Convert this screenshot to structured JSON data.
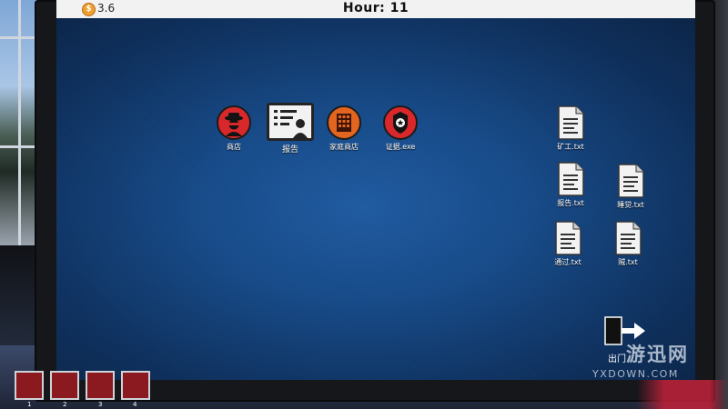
{
  "hud": {
    "money": "3.6",
    "coin_symbol": "$",
    "hour": "Hour:  11"
  },
  "desktop_apps": [
    {
      "label": "商店",
      "icon": "spy-icon"
    },
    {
      "label": "报告",
      "icon": "report-icon"
    },
    {
      "label": "家庭商店",
      "icon": "house-shop-icon"
    },
    {
      "label": "证据.exe",
      "icon": "evidence-badge-icon"
    }
  ],
  "files": [
    {
      "label": "矿工.txt"
    },
    {
      "label": "报告.txt"
    },
    {
      "label": "睡觉.txt"
    },
    {
      "label": "通过.txt"
    },
    {
      "label": "贼.txt"
    }
  ],
  "exit": {
    "label": "出门"
  },
  "slots": [
    "1",
    "2",
    "3",
    "4"
  ],
  "watermark": {
    "main": "游迅网",
    "sub": "YXDOWN.COM"
  },
  "colors": {
    "screen_bg": "#164a88",
    "app_red": "#d8262a",
    "app_orange": "#e2641e",
    "slot_red": "#8a1a1f"
  }
}
